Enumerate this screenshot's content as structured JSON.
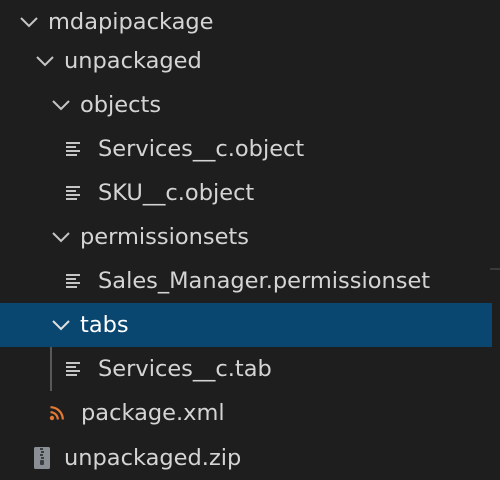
{
  "explorer": {
    "rows": [
      {
        "label": "mdapipackage",
        "kind": "folder",
        "expanded": true,
        "icon": "chevron-down-icon"
      },
      {
        "label": "unpackaged",
        "kind": "folder",
        "expanded": true,
        "icon": "chevron-down-icon"
      },
      {
        "label": "objects",
        "kind": "folder",
        "expanded": true,
        "icon": "chevron-down-icon"
      },
      {
        "label": "Services__c.object",
        "kind": "file",
        "icon": "file-lines-icon"
      },
      {
        "label": "SKU__c.object",
        "kind": "file",
        "icon": "file-lines-icon"
      },
      {
        "label": "permissionsets",
        "kind": "folder",
        "expanded": true,
        "icon": "chevron-down-icon"
      },
      {
        "label": "Sales_Manager.permissionset",
        "kind": "file",
        "icon": "file-lines-icon"
      },
      {
        "label": "tabs",
        "kind": "folder",
        "expanded": true,
        "selected": true,
        "icon": "chevron-down-icon"
      },
      {
        "label": "Services__c.tab",
        "kind": "file",
        "icon": "file-lines-icon"
      },
      {
        "label": "package.xml",
        "kind": "file",
        "icon": "rss-icon"
      },
      {
        "label": "unpackaged.zip",
        "kind": "file",
        "icon": "zip-archive-icon"
      }
    ]
  },
  "colors": {
    "background": "#1e1e1e",
    "selection": "#094771",
    "text": "#d4d4d4",
    "rss_icon": "#e37933",
    "zip_icon": "#8a8f95",
    "guide": "#585858"
  }
}
